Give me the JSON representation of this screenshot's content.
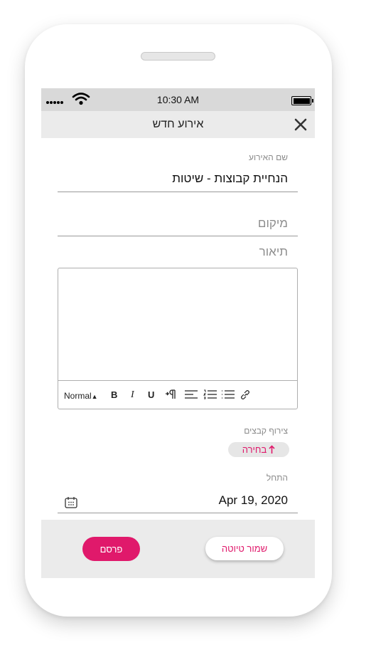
{
  "status_bar": {
    "time": "10:30 AM",
    "icons": [
      "signal-dots-icon",
      "wifi-icon",
      "battery-icon"
    ]
  },
  "header": {
    "title": "אירוע חדש",
    "close_icon": "close-icon"
  },
  "form": {
    "event_name": {
      "label": "שם האירוע",
      "value": "הנחיית קבוצות - שיטות"
    },
    "location": {
      "placeholder": "מיקום"
    },
    "description": {
      "label": "תיאור",
      "toolbar": {
        "format_select": "Normal",
        "bold": "B",
        "italic": "I",
        "underline": "U",
        "icons": [
          "text-direction-icon",
          "align-icon",
          "ordered-list-icon",
          "bullet-list-icon",
          "link-icon"
        ]
      }
    },
    "attachments": {
      "label": "צירוף קבצים",
      "choose_label": "בחירה",
      "choose_icon": "upload-arrow-icon"
    },
    "start": {
      "label": "התחל",
      "value": "Apr 19, 2020",
      "icon": "calendar-icon"
    }
  },
  "footer": {
    "publish_label": "פרסם",
    "save_draft_label": "שמור טיוטה"
  },
  "colors": {
    "accent": "#e0196b",
    "bar_gray": "#ebebeb",
    "status_gray": "#d9d9d9"
  }
}
